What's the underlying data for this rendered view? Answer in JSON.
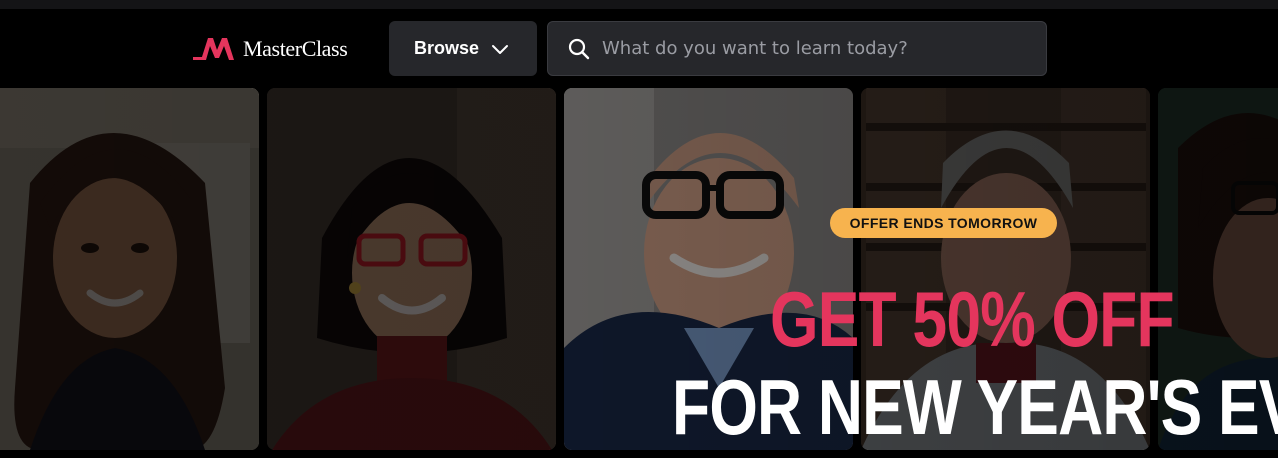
{
  "header": {
    "logo_text": "MasterClass",
    "browse_label": "Browse",
    "search_placeholder": "What do you want to learn today?"
  },
  "promo": {
    "badge": "OFFER ENDS TOMORROW",
    "headline": "GET 50% OFF",
    "subheadline": "FOR NEW YEAR'S EVE"
  },
  "colors": {
    "brand_red": "#e4355d",
    "badge_bg": "#f7b34e",
    "header_control_bg": "#26272b"
  }
}
